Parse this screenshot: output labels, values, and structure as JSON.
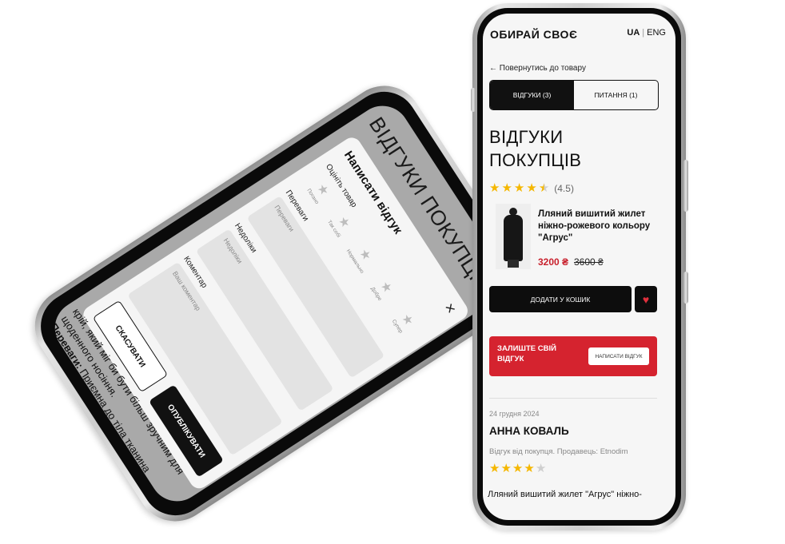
{
  "left_screen": {
    "background_title": "ВІДГУКИ ПОКУПЦІВ",
    "background_text_1": "крій, який міг би бути більш зручним для щоденного носіння.",
    "background_text_2_label": "Переваги:",
    "background_text_2": "Приємна до тіла тканина",
    "modal": {
      "title": "Написати відгук",
      "close": "×",
      "rate_label": "Оцініть товар",
      "rate_options": [
        "Погано",
        "Так собі",
        "Нормально",
        "Добре",
        "Супер"
      ],
      "pros_label": "Переваги",
      "pros_placeholder": "Переваги",
      "cons_label": "Недоліки",
      "cons_placeholder": "Недоліки",
      "comment_label": "Коментар",
      "comment_placeholder": "Ваш коментар",
      "cancel_label": "СКАСУВАТИ",
      "publish_label": "ОПУБЛІКУВАТИ"
    }
  },
  "right_screen": {
    "logo": "ОБИРАЙ СВОЄ",
    "lang_active": "UA",
    "lang_sep": "|",
    "lang_other": "ENG",
    "back_link": "← Повернутись до товару",
    "tabs": [
      {
        "label": "ВІДГУКИ (3)",
        "active": true
      },
      {
        "label": "ПИТАННЯ (1)",
        "active": false
      }
    ],
    "title": "ВІДГУКИ ПОКУПЦІВ",
    "rating_text": "(4.5)",
    "rating_value": 4.5,
    "product": {
      "name": "Лляний вишитий жилет ніжно-рожевого кольору \"Агрус\"",
      "price": "3200 ₴",
      "old_price": "3600 ₴"
    },
    "add_to_cart": "ДОДАТИ У КОШИК",
    "wishlist_icon": "heart-icon",
    "banner": {
      "text": "ЗАЛИШТЕ СВІЙ ВІДГУК",
      "button": "НАПИСАТИ ВІДГУК"
    },
    "review": {
      "date": "24 грудня 2024",
      "author": "АННА КОВАЛЬ",
      "meta": "Відгук від покупця. Продавець: Etnodim",
      "stars": 4,
      "text": "Лляний вишитий жилет \"Агрус\" ніжно-"
    },
    "colors": {
      "accent": "#d5232f",
      "star": "#f5b700",
      "dark": "#0d0d0d"
    }
  }
}
